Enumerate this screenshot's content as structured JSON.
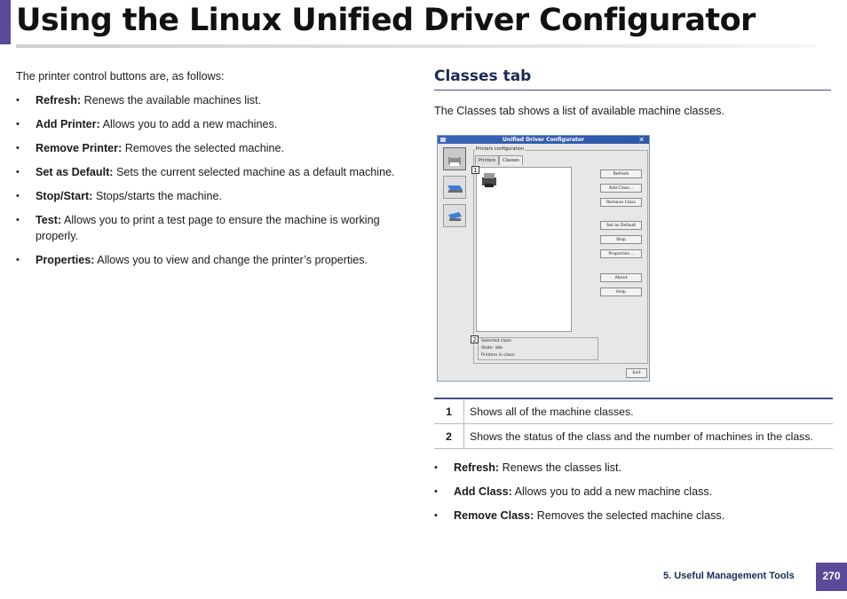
{
  "page": {
    "title": "Using the Linux Unified Driver Configurator",
    "footer_section": "5.  Useful Management Tools",
    "page_number": "270",
    "accent_color": "#5b4a9a"
  },
  "left": {
    "intro": "The printer control buttons are, as follows:",
    "items": [
      {
        "term": "Refresh:",
        "desc": " Renews the available machines list."
      },
      {
        "term": "Add Printer:",
        "desc": " Allows you to add a new machines."
      },
      {
        "term": "Remove Printer:",
        "desc": " Removes the selected machine."
      },
      {
        "term": "Set as Default:",
        "desc": " Sets the current selected machine as a default machine."
      },
      {
        "term": "Stop/Start:",
        "desc": " Stops/starts the machine."
      },
      {
        "term": "Test:",
        "desc": " Allows you to print a test page to ensure the machine is working properly."
      },
      {
        "term": "Properties:",
        "desc": " Allows you to view and change the printer’s properties."
      }
    ]
  },
  "right": {
    "heading": "Classes tab",
    "description": "The Classes tab shows a list of available machine classes.",
    "screenshot": {
      "window_title": "Unified Driver Configurator",
      "close_glyph": "✕",
      "group_label": "Printers configuration",
      "tabs": [
        "Printers",
        "Classes"
      ],
      "buttons": [
        "Refresh",
        "Add Class...",
        "Remove Class",
        "Set as Default",
        "Stop",
        "Properties...",
        "About",
        "Help"
      ],
      "status_lines": [
        "Selected class:",
        "State: idle",
        "Printers in class:"
      ],
      "exit_label": "Exit",
      "callouts": [
        "1",
        "2"
      ]
    },
    "table": [
      {
        "num": "1",
        "text": "Shows all of the machine classes."
      },
      {
        "num": "2",
        "text": "Shows the status of the class and the number of machines in the class."
      }
    ],
    "items": [
      {
        "term": "Refresh:",
        "desc": " Renews the classes list."
      },
      {
        "term": "Add Class:",
        "desc": " Allows you to add a new machine class."
      },
      {
        "term": "Remove Class:",
        "desc": " Removes the selected machine class."
      }
    ]
  }
}
